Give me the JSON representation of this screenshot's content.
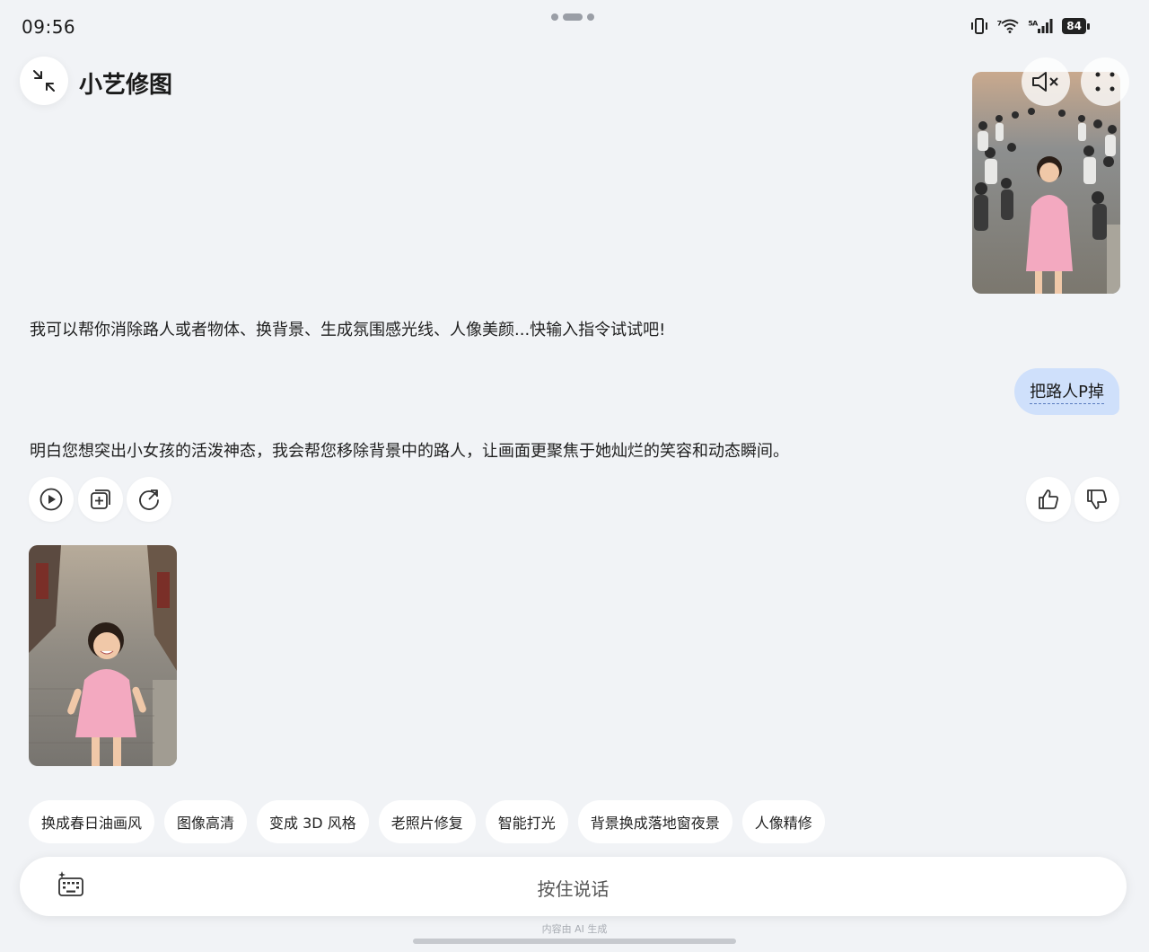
{
  "status_bar": {
    "time": "09:56",
    "network_1": "⁷",
    "network_2": "⁵ᴬ",
    "battery": "84"
  },
  "header": {
    "title": "小艺修图"
  },
  "conversation": {
    "assistant_intro": "我可以帮你消除路人或者物体、换背景、生成氛围感光线、人像美颜...快输入指令试试吧!",
    "user_message": "把路人P掉",
    "assistant_reply": "明白您想突出小女孩的活泼神态，我会帮您移除背景中的路人，让画面更聚焦于她灿烂的笑容和动态瞬间。"
  },
  "suggestions": [
    "换成春日油画风",
    "图像高清",
    "变成 3D 风格",
    "老照片修复",
    "智能打光",
    "背景换成落地窗夜景",
    "人像精修"
  ],
  "input": {
    "hold_to_talk": "按住说话",
    "ai_note": "内容由 AI 生成"
  },
  "colors": {
    "background": "#f1f3f6",
    "user_bubble": "#cfe0fb",
    "dress_pink": "#f3a9c0"
  },
  "icons": [
    "collapse-icon",
    "mute-speaker-icon",
    "more-icon",
    "play-icon",
    "add-copy-icon",
    "refresh-icon",
    "thumbs-up-icon",
    "thumbs-down-icon",
    "keyboard-icon"
  ]
}
